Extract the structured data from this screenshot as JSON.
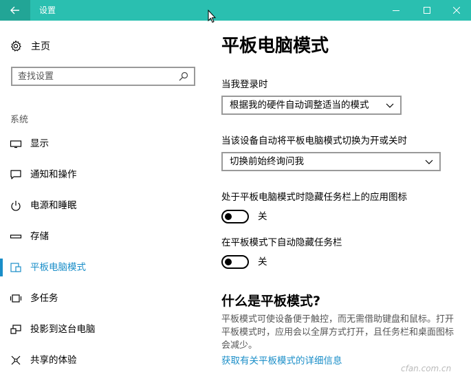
{
  "window": {
    "title": "设置"
  },
  "sidebar": {
    "home_label": "主页",
    "search_placeholder": "查找设置",
    "section_title": "系统",
    "items": [
      {
        "label": "显示",
        "icon": "monitor-icon"
      },
      {
        "label": "通知和操作",
        "icon": "notification-icon"
      },
      {
        "label": "电源和睡眠",
        "icon": "power-icon"
      },
      {
        "label": "存储",
        "icon": "storage-icon"
      },
      {
        "label": "平板电脑模式",
        "icon": "tablet-mode-icon",
        "active": true
      },
      {
        "label": "多任务",
        "icon": "multitasking-icon"
      },
      {
        "label": "投影到这台电脑",
        "icon": "projecting-icon"
      },
      {
        "label": "共享的体验",
        "icon": "shared-experiences-icon"
      }
    ]
  },
  "main": {
    "title": "平板电脑模式",
    "signin_label": "当我登录时",
    "signin_value": "根据我的硬件自动调整适当的模式",
    "switch_label": "当该设备自动将平板电脑模式切换为开或关时",
    "switch_value": "切换前始终询问我",
    "hide_icons_label": "处于平板电脑模式时隐藏任务栏上的应用图标",
    "hide_icons_state": "关",
    "hide_taskbar_label": "在平板模式下自动隐藏任务栏",
    "hide_taskbar_state": "关",
    "what_is_heading": "什么是平板模式?",
    "what_is_desc": "平板模式可使设备便于触控，而无需借助键盘和鼠标。打开平板模式时，应用会以全屏方式打开，且任务栏和桌面图标会减少。",
    "learn_more_link": "获取有关平板模式的详细信息"
  },
  "watermark": "cfan.com.cn",
  "colors": {
    "titlebar": "#2abfb0",
    "back_button": "#22a596",
    "accent": "#1a8ec8"
  }
}
